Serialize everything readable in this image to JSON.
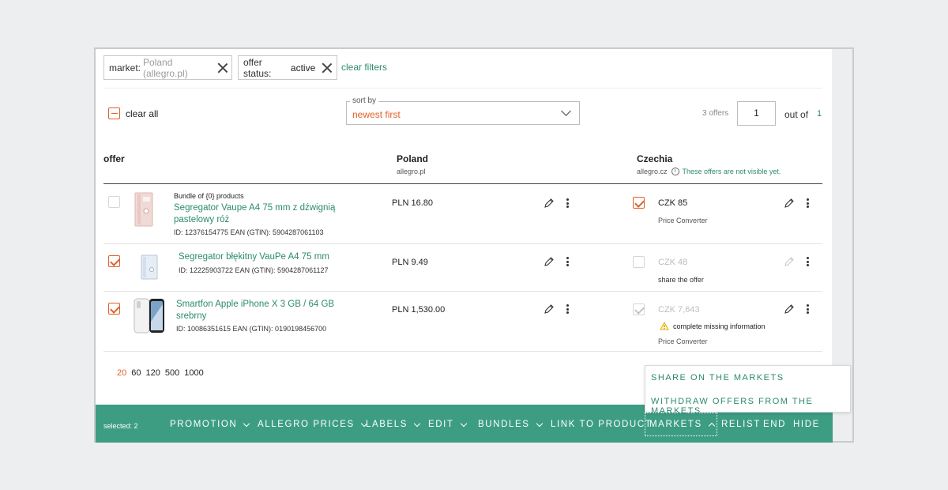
{
  "filters": {
    "market": {
      "key": "market:",
      "value": "Poland (allegro.pl)"
    },
    "status": {
      "key": "offer status:",
      "value": "active"
    },
    "clear_filters": "clear filters"
  },
  "toolbar": {
    "clear_all": "clear all",
    "sort_label": "sort by",
    "sort_value": "newest first",
    "offers_count": "3 offers",
    "page": "1",
    "out_of": "out of",
    "total_pages": "1"
  },
  "table": {
    "col_offer": "offer",
    "poland": {
      "title": "Poland",
      "sub": "allegro.pl"
    },
    "czechia": {
      "title": "Czechia",
      "sub": "allegro.cz",
      "notice": "These offers are not visible yet."
    },
    "rows": [
      {
        "bundle": "Bundle of {0} products",
        "name_line1": "Segregator Vaupe A4 75 mm z dźwignią",
        "name_line2": "pastelowy róż",
        "ids": "ID: 12376154775   EAN (GTIN): 5904287061103",
        "pl_price": "PLN 16.80",
        "cz_price": "CZK 85",
        "cz_sub": "Price Converter",
        "checked": false,
        "cz_checked": true
      },
      {
        "name_line1": "Segregator błękitny VauPe A4 75 mm",
        "ids": "ID: 12225903722   EAN (GTIN): 5904287061127",
        "pl_price": "PLN 9.49",
        "cz_price": "CZK 48",
        "cz_sub": "share the offer",
        "checked": true,
        "cz_checked": false
      },
      {
        "name_line1": "Smartfon Apple iPhone X 3 GB / 64 GB",
        "name_line2": "srebrny",
        "ids": "ID: 10086351615   EAN (GTIN): 0190198456700",
        "pl_price": "PLN 1,530.00",
        "cz_price": "CZK 7,643",
        "cz_warning": "complete missing information",
        "cz_sub": "Price Converter",
        "checked": true,
        "cz_checked": true
      }
    ]
  },
  "page_sizes": [
    "20",
    "60",
    "120",
    "500",
    "1000"
  ],
  "page_size_selected": "20",
  "actions": {
    "selected": "selected: 2",
    "promotion": "PROMOTION",
    "allegro_prices": "ALLEGRO PRICES",
    "labels": "LABELS",
    "edit": "EDIT",
    "bundles": "BUNDLES",
    "link_to_product": "LINK TO PRODUCT",
    "markets": "MARKETS",
    "relist": "RELIST",
    "end": "END",
    "hide": "HIDE"
  },
  "markets_menu": {
    "share": "SHARE ON THE MARKETS",
    "withdraw": "WITHDRAW OFFERS FROM THE MARKETS"
  },
  "colors": {
    "accent": "#e0602a",
    "brand": "#3d9d83",
    "link": "#2c8a6e"
  }
}
